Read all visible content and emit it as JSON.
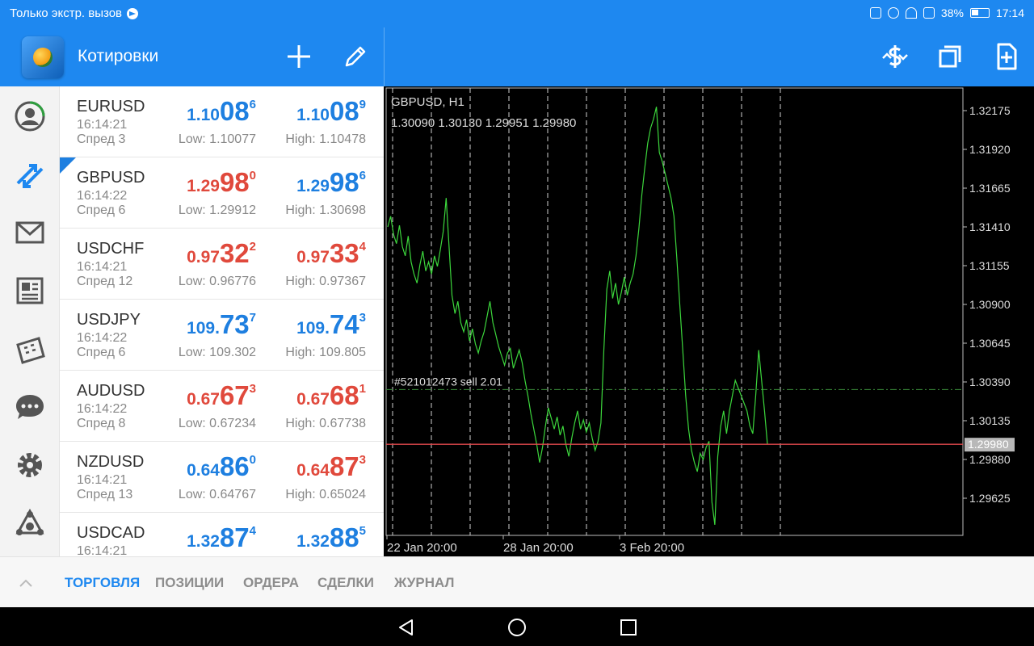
{
  "status_bar": {
    "carrier_text": "Только экстр. вызов",
    "battery": "38%",
    "time": "17:14"
  },
  "header": {
    "title": "Котировки",
    "icons": [
      "add-icon",
      "edit-icon",
      "currency-icon",
      "windows-icon",
      "new-document-icon"
    ]
  },
  "sidenav": {
    "items": [
      "account-icon",
      "quotes-icon",
      "mail-icon",
      "news-icon",
      "calendar-icon",
      "chat-icon",
      "settings-icon",
      "community-icon"
    ]
  },
  "quotes": [
    {
      "symbol": "EURUSD",
      "time": "16:14:21",
      "spread": "Спред 3",
      "bid": {
        "pre": "1.10",
        "big": "08",
        "sup": "6",
        "dir": "up"
      },
      "ask": {
        "pre": "1.10",
        "big": "08",
        "sup": "9",
        "dir": "up"
      },
      "low": "Low: 1.10077",
      "high": "High: 1.10478"
    },
    {
      "symbol": "GBPUSD",
      "time": "16:14:22",
      "spread": "Спред 6",
      "bid": {
        "pre": "1.29",
        "big": "98",
        "sup": "0",
        "dir": "down"
      },
      "ask": {
        "pre": "1.29",
        "big": "98",
        "sup": "6",
        "dir": "up"
      },
      "low": "Low: 1.29912",
      "high": "High: 1.30698",
      "selected": true
    },
    {
      "symbol": "USDCHF",
      "time": "16:14:21",
      "spread": "Спред 12",
      "bid": {
        "pre": "0.97",
        "big": "32",
        "sup": "2",
        "dir": "down"
      },
      "ask": {
        "pre": "0.97",
        "big": "33",
        "sup": "4",
        "dir": "down"
      },
      "low": "Low: 0.96776",
      "high": "High: 0.97367"
    },
    {
      "symbol": "USDJPY",
      "time": "16:14:22",
      "spread": "Спред 6",
      "bid": {
        "pre": "109.",
        "big": "73",
        "sup": "7",
        "dir": "up"
      },
      "ask": {
        "pre": "109.",
        "big": "74",
        "sup": "3",
        "dir": "up"
      },
      "low": "Low: 109.302",
      "high": "High: 109.805"
    },
    {
      "symbol": "AUDUSD",
      "time": "16:14:22",
      "spread": "Спред 8",
      "bid": {
        "pre": "0.67",
        "big": "67",
        "sup": "3",
        "dir": "down"
      },
      "ask": {
        "pre": "0.67",
        "big": "68",
        "sup": "1",
        "dir": "down"
      },
      "low": "Low: 0.67234",
      "high": "High: 0.67738"
    },
    {
      "symbol": "NZDUSD",
      "time": "16:14:21",
      "spread": "Спред 13",
      "bid": {
        "pre": "0.64",
        "big": "86",
        "sup": "0",
        "dir": "up"
      },
      "ask": {
        "pre": "0.64",
        "big": "87",
        "sup": "3",
        "dir": "down"
      },
      "low": "Low: 0.64767",
      "high": "High: 0.65024"
    },
    {
      "symbol": "USDCAD",
      "time": "16:14:21",
      "spread": "",
      "bid": {
        "pre": "1.32",
        "big": "87",
        "sup": "4",
        "dir": "up"
      },
      "ask": {
        "pre": "1.32",
        "big": "88",
        "sup": "5",
        "dir": "up"
      },
      "low": "",
      "high": ""
    }
  ],
  "chart": {
    "symbol_tf": "GBPUSD, H1",
    "ohlc": "1.30090 1.30130 1.29951 1.29980",
    "order_label": "#521012473 sell 2.01",
    "order_price": 1.3034,
    "current_price": 1.2998,
    "current_price_label": "1.29980",
    "y_ticks": [
      "1.32175",
      "1.31920",
      "1.31665",
      "1.31410",
      "1.31155",
      "1.30900",
      "1.30645",
      "1.30390",
      "1.30135",
      "1.29880",
      "1.29625"
    ],
    "x_ticks": [
      "22 Jan 20:00",
      "28 Jan 20:00",
      "3 Feb 20:00"
    ],
    "y_min": 1.294,
    "y_max": 1.323,
    "line_color": "#3cd63c",
    "price_line_color": "#e0484b",
    "order_line_color": "#3a8a3a",
    "series": [
      1.3141,
      1.3148,
      1.3136,
      1.313,
      1.3142,
      1.3128,
      1.3122,
      1.3135,
      1.3118,
      1.311,
      1.3104,
      1.3116,
      1.3125,
      1.3112,
      1.3118,
      1.311,
      1.3122,
      1.3115,
      1.3126,
      1.3138,
      1.316,
      1.3128,
      1.3096,
      1.3084,
      1.3092,
      1.3078,
      1.3072,
      1.308,
      1.3066,
      1.3074,
      1.3064,
      1.3058,
      1.3066,
      1.3072,
      1.3082,
      1.3092,
      1.3078,
      1.307,
      1.3062,
      1.3056,
      1.305,
      1.3058,
      1.3061,
      1.3048,
      1.3054,
      1.306,
      1.3052,
      1.304,
      1.303,
      1.3018,
      1.3008,
      1.2998,
      1.2986,
      1.2996,
      1.301,
      1.3022,
      1.3015,
      1.3008,
      1.3016,
      1.3004,
      1.301,
      1.2998,
      1.299,
      1.3002,
      1.3012,
      1.302,
      1.3008,
      1.3014,
      1.3006,
      1.3012,
      1.3002,
      1.2994,
      1.3,
      1.3012,
      1.306,
      1.31,
      1.3112,
      1.3094,
      1.3104,
      1.309,
      1.3098,
      1.3108,
      1.3096,
      1.3104,
      1.311,
      1.3122,
      1.314,
      1.3162,
      1.318,
      1.3196,
      1.3206,
      1.3212,
      1.322,
      1.319,
      1.3184,
      1.3176,
      1.3168,
      1.316,
      1.3148,
      1.312,
      1.309,
      1.306,
      1.303,
      1.3008,
      1.2994,
      1.2986,
      1.298,
      1.2992,
      1.2988,
      1.2996,
      1.3,
      1.296,
      1.2945,
      1.299,
      1.301,
      1.302,
      1.3005,
      1.302,
      1.303,
      1.304,
      1.3035,
      1.303,
      1.3025,
      1.302,
      1.301,
      1.3005,
      1.303,
      1.306,
      1.304,
      1.302,
      1.2998
    ]
  },
  "tabs": [
    {
      "label": "ТОРГОВЛЯ",
      "active": true
    },
    {
      "label": "ПОЗИЦИИ"
    },
    {
      "label": "ОРДЕРА"
    },
    {
      "label": "СДЕЛКИ"
    },
    {
      "label": "ЖУРНАЛ"
    }
  ]
}
